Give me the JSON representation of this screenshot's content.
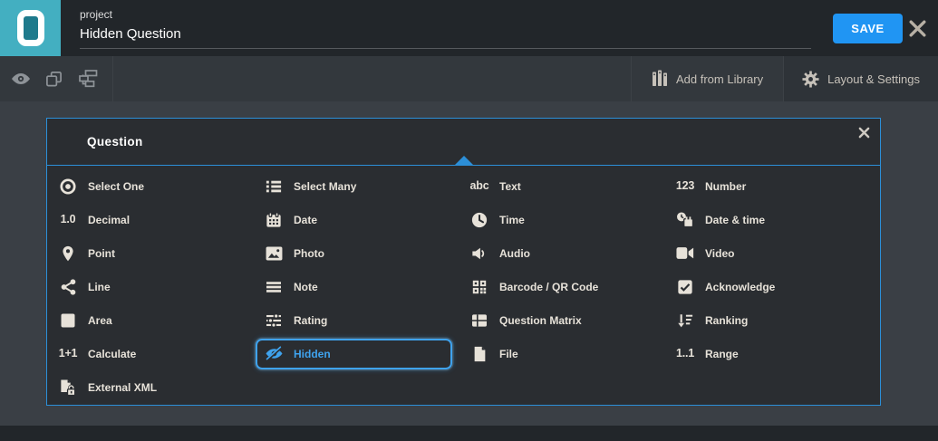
{
  "header": {
    "project_label": "project",
    "form_title": "Hidden Question",
    "save_label": "SAVE"
  },
  "toolbar": {
    "add_from_library_label": "Add from Library",
    "layout_settings_label": "Layout & Settings"
  },
  "modal": {
    "title": "Question",
    "items": [
      {
        "label": "Select One",
        "icon": "radio-icon"
      },
      {
        "label": "Select Many",
        "icon": "checklist-icon"
      },
      {
        "label": "Text",
        "icon": "abc-glyph-icon",
        "glyph": "abc"
      },
      {
        "label": "Number",
        "icon": "123-glyph-icon",
        "glyph": "123"
      },
      {
        "label": "Decimal",
        "icon": "decimal-glyph-icon",
        "glyph": "1.0"
      },
      {
        "label": "Date",
        "icon": "calendar-icon"
      },
      {
        "label": "Time",
        "icon": "clock-icon"
      },
      {
        "label": "Date & time",
        "icon": "calendar-clock-icon"
      },
      {
        "label": "Point",
        "icon": "map-pin-icon"
      },
      {
        "label": "Photo",
        "icon": "image-icon"
      },
      {
        "label": "Audio",
        "icon": "speaker-icon"
      },
      {
        "label": "Video",
        "icon": "video-camera-icon"
      },
      {
        "label": "Line",
        "icon": "share-nodes-icon"
      },
      {
        "label": "Note",
        "icon": "note-lines-icon"
      },
      {
        "label": "Barcode / QR Code",
        "icon": "qr-code-icon"
      },
      {
        "label": "Acknowledge",
        "icon": "checkbox-check-icon"
      },
      {
        "label": "Area",
        "icon": "square-icon"
      },
      {
        "label": "Rating",
        "icon": "rating-sliders-icon"
      },
      {
        "label": "Question Matrix",
        "icon": "table-grid-icon"
      },
      {
        "label": "Ranking",
        "icon": "sort-ranking-icon"
      },
      {
        "label": "Calculate",
        "icon": "calculate-glyph-icon",
        "glyph": "1+1"
      },
      {
        "label": "Hidden",
        "icon": "eye-slash-icon",
        "selected": true
      },
      {
        "label": "File",
        "icon": "file-icon"
      },
      {
        "label": "Range",
        "icon": "range-glyph-icon",
        "glyph": "1..1"
      },
      {
        "label": "External XML",
        "icon": "file-lock-icon"
      }
    ]
  },
  "colors": {
    "accent_blue": "#2095F3",
    "modal_border_blue": "#2C8FD8",
    "selected_blue": "#3FA3EE",
    "brand_teal": "#43AFC1",
    "icon_bone": "#E7E2D9"
  }
}
